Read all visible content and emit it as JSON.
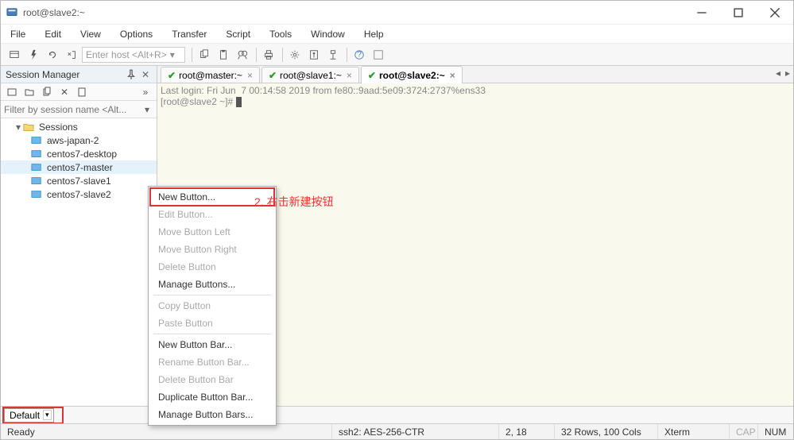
{
  "window": {
    "title": "root@slave2:~"
  },
  "menu": [
    "File",
    "Edit",
    "View",
    "Options",
    "Transfer",
    "Script",
    "Tools",
    "Window",
    "Help"
  ],
  "toolbar": {
    "host_placeholder": "Enter host <Alt+R>"
  },
  "session_panel": {
    "title": "Session Manager",
    "filter_placeholder": "Filter by session name <Alt...",
    "root": "Sessions",
    "items": [
      {
        "label": "aws-japan-2",
        "selected": false
      },
      {
        "label": "centos7-desktop",
        "selected": false
      },
      {
        "label": "centos7-master",
        "selected": true
      },
      {
        "label": "centos7-slave1",
        "selected": false
      },
      {
        "label": "centos7-slave2",
        "selected": false
      }
    ]
  },
  "tabs": [
    {
      "label": "root@master:~",
      "active": false
    },
    {
      "label": "root@slave1:~",
      "active": false
    },
    {
      "label": "root@slave2:~",
      "active": true
    }
  ],
  "terminal": {
    "line1": "Last login: Fri Jun  7 00:14:58 2019 from fe80::9aad:5e09:3724:2737%ens33",
    "prompt": "[root@slave2 ~]# "
  },
  "buttonbar": {
    "label": "Default"
  },
  "status": {
    "ready": "Ready",
    "proto": "ssh2: AES-256-CTR",
    "pos": "2, 18",
    "size": "32 Rows, 100 Cols",
    "term": "Xterm",
    "cap": "CAP",
    "num": "NUM"
  },
  "ctx": [
    {
      "label": "New Button...",
      "enabled": true,
      "highlight": true
    },
    {
      "label": "Edit Button...",
      "enabled": false
    },
    {
      "label": "Move Button Left",
      "enabled": false
    },
    {
      "label": "Move Button Right",
      "enabled": false
    },
    {
      "label": "Delete Button",
      "enabled": false
    },
    {
      "label": "Manage Buttons...",
      "enabled": true
    },
    {
      "sep": true
    },
    {
      "label": "Copy Button",
      "enabled": false
    },
    {
      "label": "Paste Button",
      "enabled": false
    },
    {
      "sep": true
    },
    {
      "label": "New Button Bar...",
      "enabled": true
    },
    {
      "label": "Rename Button Bar...",
      "enabled": false
    },
    {
      "label": "Delete Button Bar",
      "enabled": false
    },
    {
      "label": "Duplicate Button Bar...",
      "enabled": true
    },
    {
      "label": "Manage Button Bars...",
      "enabled": true
    }
  ],
  "annotation": "2. 右击新建按钮"
}
